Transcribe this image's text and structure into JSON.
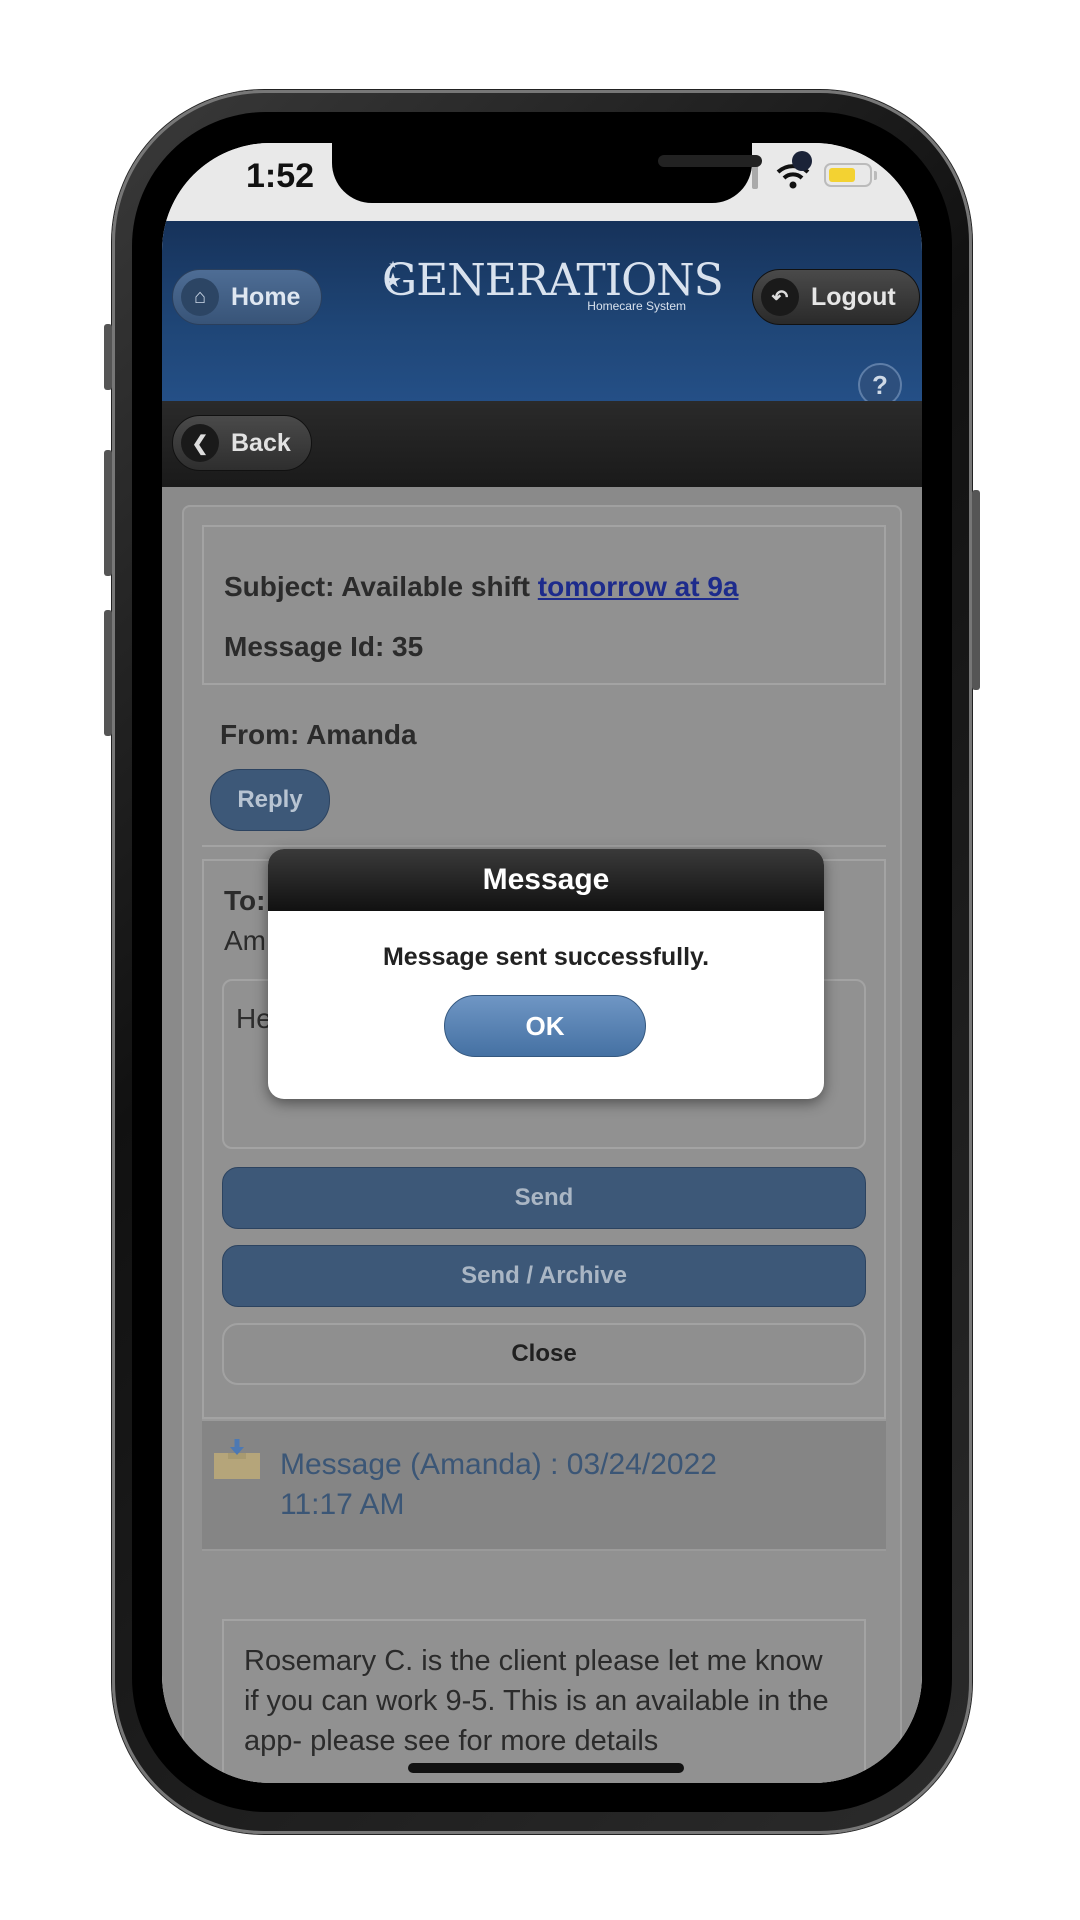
{
  "status_bar": {
    "time": "1:52"
  },
  "header": {
    "home_label": "Home",
    "logout_label": "Logout",
    "logo_title": "GENERATIONS",
    "logo_subtitle": "Homecare System",
    "help_label": "?"
  },
  "nav": {
    "back_label": "Back"
  },
  "message": {
    "subject_prefix": "Subject: Available shift ",
    "subject_link": "tomorrow at 9a",
    "message_id": "Message Id: 35",
    "from": "From: Amanda",
    "reply_label": "Reply",
    "to_label": "To:",
    "to_name": "Am",
    "reply_text_partial": "He                                                      ft to"
  },
  "actions": {
    "send_label": "Send",
    "send_archive_label": "Send / Archive",
    "close_label": "Close"
  },
  "thread": {
    "item_line1": "Message (Amanda) : 03/24/2022",
    "item_line2": "11:17 AM",
    "body": "Rosemary C. is the client please let me know if you can work 9-5. This is an available in the app- please see for more details"
  },
  "modal": {
    "title": "Message",
    "text": "Message sent successfully.",
    "ok_label": "OK"
  },
  "colors": {
    "header_blue": "#1f4677",
    "ok_blue": "#5a84b6",
    "overlay_gray": "#8a8a8a"
  }
}
